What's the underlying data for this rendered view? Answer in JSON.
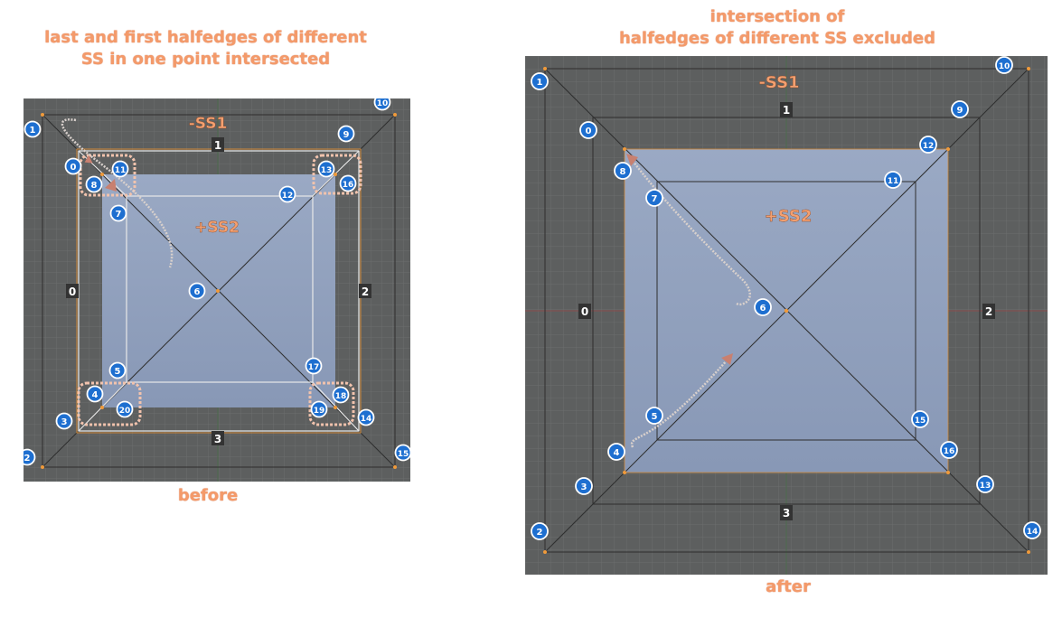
{
  "left_panel": {
    "heading": [
      "last and first halfedges of different",
      "SS in one point intersected"
    ],
    "footer": "before",
    "ss1_label": "-SS1",
    "ss2_label": "+SS2",
    "edge_labels": [
      "0",
      "1",
      "2",
      "3"
    ],
    "badges": [
      "0",
      "1",
      "2",
      "3",
      "4",
      "5",
      "6",
      "7",
      "8",
      "9",
      "10",
      "11",
      "12",
      "13",
      "14",
      "15",
      "16",
      "17",
      "18",
      "19",
      "20"
    ]
  },
  "right_panel": {
    "heading": [
      "intersection of",
      "halfedges of different SS excluded"
    ],
    "footer": "after",
    "ss1_label": "-SS1",
    "ss2_label": "+SS2",
    "edge_labels": [
      "0",
      "1",
      "2",
      "3"
    ],
    "badges": [
      "0",
      "1",
      "2",
      "3",
      "4",
      "5",
      "6",
      "7",
      "8",
      "9",
      "10",
      "11",
      "12",
      "13",
      "14",
      "15",
      "16"
    ]
  },
  "colors": {
    "viewport_bg": "#5d5f5f",
    "face_fill": "#8e9fbd",
    "badge_fill": "#1e6fd0",
    "caption": "#f49a6a"
  }
}
